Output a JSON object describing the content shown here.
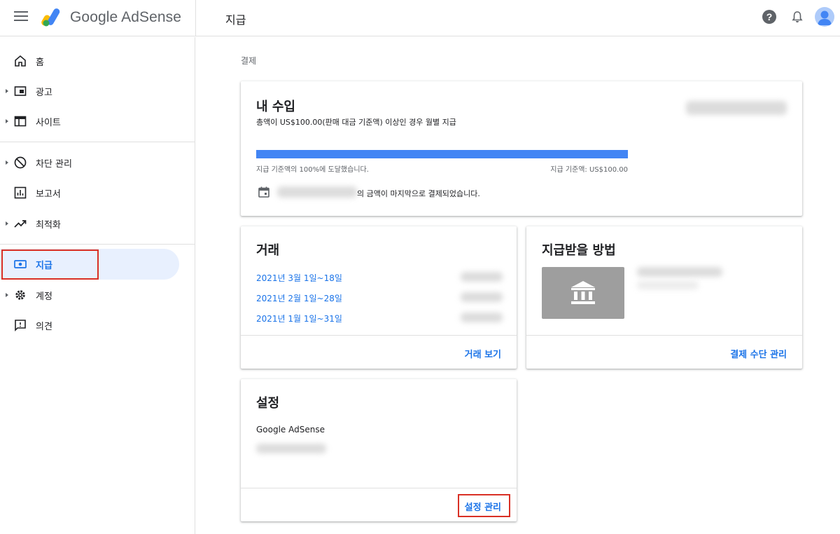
{
  "header": {
    "brand": "Google AdSense",
    "page_title": "지급"
  },
  "sidebar": {
    "items": [
      {
        "label": "홈"
      },
      {
        "label": "광고"
      },
      {
        "label": "사이트"
      },
      {
        "label": "차단 관리"
      },
      {
        "label": "보고서"
      },
      {
        "label": "최적화"
      },
      {
        "label": "지급"
      },
      {
        "label": "계정"
      },
      {
        "label": "의견"
      }
    ]
  },
  "breadcrumb": "결제",
  "earnings": {
    "title": "내 수입",
    "subtitle": "총액이 US$100.00(판매 대금 기준액) 이상인 경우 월별 지급",
    "progress_fraction": 1.0,
    "progress_left": "지급 기준액의 100%에 도달했습니다.",
    "progress_right": "지급 기준액: US$100.00",
    "last_payment_suffix": "의 금액이 마지막으로 결제되었습니다."
  },
  "transactions": {
    "title": "거래",
    "rows": [
      {
        "period": "2021년 3월 1일~18일"
      },
      {
        "period": "2021년 2월 1일~28일"
      },
      {
        "period": "2021년 1월 1일~31일"
      }
    ],
    "action": "거래 보기"
  },
  "payment_method": {
    "title": "지급받을 방법",
    "action": "결제 수단 관리"
  },
  "settings": {
    "title": "설정",
    "account_name": "Google AdSense",
    "action": "설정 관리"
  },
  "colors": {
    "accent": "#1a73e8",
    "progress": "#4285f4",
    "highlight": "#d93025"
  }
}
